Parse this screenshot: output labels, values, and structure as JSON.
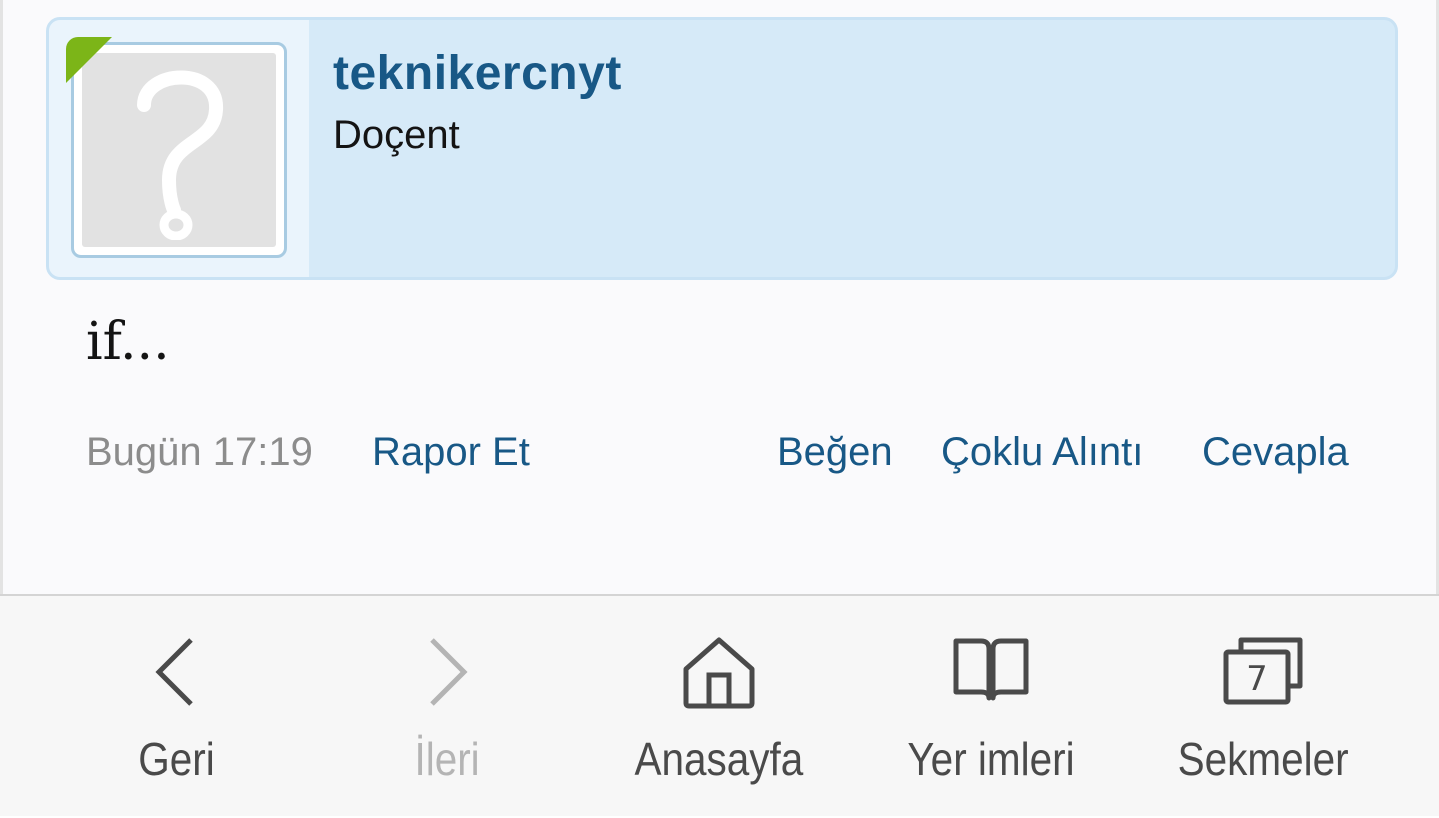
{
  "post": {
    "username": "teknikercnyt",
    "user_title": "Doçent",
    "message": "if...",
    "time": "Bugün 17:19",
    "actions": {
      "report": "Rapor Et",
      "like": "Beğen",
      "multiquote": "Çoklu Alıntı",
      "reply": "Cevapla"
    },
    "online_status_color": "#7cb518"
  },
  "bottom_nav": {
    "back": {
      "label": "Geri",
      "icon": "chevron-left-icon"
    },
    "forward": {
      "label": "İleri",
      "icon": "chevron-right-icon",
      "disabled": true
    },
    "home": {
      "label": "Anasayfa",
      "icon": "home-icon"
    },
    "bookmarks": {
      "label": "Yer imleri",
      "icon": "bookmarks-icon"
    },
    "tabs": {
      "label": "Sekmeler",
      "icon": "tabs-icon",
      "count": "7"
    }
  },
  "colors": {
    "accent": "#185886",
    "card_bg": "#d6eaf8",
    "muted": "#8c8c8c"
  }
}
